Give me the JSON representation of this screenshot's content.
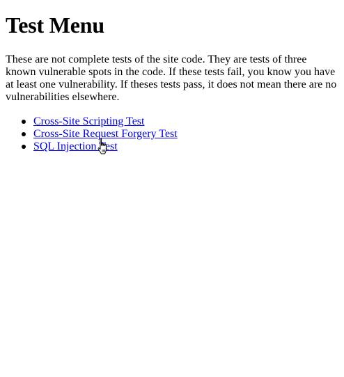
{
  "page": {
    "title": "Test Menu",
    "intro": "These are not complete tests of the site code. They are tests of three known vulnerable spots in the code. If these tests fail, you know you have at least one vulnerability. If theses tests pass, it does not mean there are no vulnerabilities elsewhere."
  },
  "tests": [
    {
      "label": "Cross-Site Scripting Test"
    },
    {
      "label": "Cross-Site Request Forgery Test"
    },
    {
      "label": "SQL Injection Test"
    }
  ],
  "cursor": {
    "icon": "hand-pointer-icon"
  },
  "colors": {
    "link": "#0000ee",
    "text": "#000000",
    "background": "#ffffff"
  }
}
